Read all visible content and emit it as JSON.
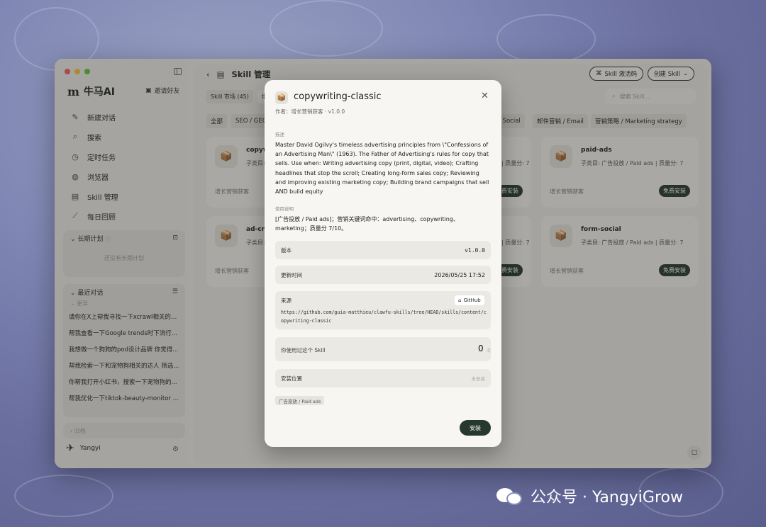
{
  "sidebar": {
    "brand_logo": "m",
    "brand": "牛马AI",
    "invite": "邀请好友",
    "nav": [
      {
        "icon": "edit-icon",
        "glyph": "✎",
        "label": "新建对话"
      },
      {
        "icon": "search-icon",
        "glyph": "⌕",
        "label": "搜索"
      },
      {
        "icon": "clock-icon",
        "glyph": "◷",
        "label": "定时任务"
      },
      {
        "icon": "globe-icon",
        "glyph": "◍",
        "label": "浏览器"
      },
      {
        "icon": "scroll-icon",
        "glyph": "▤",
        "label": "Skill 管理"
      },
      {
        "icon": "chart-icon",
        "glyph": "⟋",
        "label": "每日回顾"
      }
    ],
    "long_term": {
      "title": "长期计划",
      "empty": "还没有长期计划"
    },
    "recent": {
      "title": "最近对话",
      "group": "更早",
      "items": [
        "请你在X上帮我寻找一下xcrawl相关的帖...",
        "帮我查看一下Google trends时下流行的...",
        "我想做一个狗狗的pod设计品牌 你觉得...",
        "帮我检索一下和宠物狗相关的达人 筛选...",
        "你帮我打开小红书，搜索一下宠物狗的...",
        "帮我优化一下tiktok-beauty-monitor 改..."
      ]
    },
    "archive": "归档",
    "user": "Yangyi"
  },
  "main": {
    "title": "Skill 管理",
    "activate_btn": "Skill 激活码",
    "create_btn": "创建 Skill",
    "tabs": [
      "Skill 市场 (45)",
      "增"
    ],
    "search_placeholder": "搜索 Skill...",
    "chips": [
      "全部",
      "SEO / GEO",
      "/ Social",
      "邮件营销 / Email",
      "营销策略 / Marketing strategy"
    ],
    "cards": [
      {
        "title": "copyw",
        "sub": "子类目:",
        "author": "增长营销获客",
        "btn": ""
      },
      {
        "title": "",
        "sub": "| 质量分: 7",
        "author": "",
        "btn": "免费安装"
      },
      {
        "title": "paid-ads",
        "sub": "子类目: 广告投放 / Paid ads | 质量分: 7",
        "author": "增长营销获客",
        "btn": "免费安装"
      },
      {
        "title": "ad-cre",
        "sub": "子类目:",
        "author": "增长营销获客",
        "btn": ""
      },
      {
        "title": "",
        "sub": "| 质量分: 7",
        "author": "",
        "btn": "免费安装"
      },
      {
        "title": "form-social",
        "sub": "子类目: 广告投放 / Paid ads | 质量分: 7",
        "author": "增长营销获客",
        "btn": "免费安装"
      }
    ]
  },
  "modal": {
    "title": "copywriting-classic",
    "meta": "作者：增长营销获客 · v1.0.0",
    "desc_label": "描述",
    "description": "Master David Ogilvy's timeless advertising principles from \\\"Confessions of an Advertising Man\\\" (1963). The Father of Advertising's rules for copy that sells. Use when: Writing advertising copy (print, digital, video); Crafting headlines that stop the scroll; Creating long-form sales copy; Reviewing and improving existing marketing copy; Building brand campaigns that sell AND build equity",
    "usage_label": "使用说明",
    "usage": "[广告投放 / Paid ads]；营销关键词命中：advertising、copywriting、marketing；质量分 7/10。",
    "version_label": "版本",
    "version": "v1.0.0",
    "updated_label": "更新时间",
    "updated": "2026/05/25 17:52",
    "source_label": "来源",
    "source_badge": "GitHub",
    "source_url": "https://github.com/guia-matthieu/clawfu-skills/tree/HEAD/skills/content/copywriting-classic",
    "used_label": "你使用过这个 Skill",
    "used_count": "0",
    "used_unit": "次",
    "location_label": "安装位置",
    "location": "未安装",
    "tag": "广告投放 / Paid ads",
    "install": "安装"
  },
  "watermark": "公众号 · YangyiGrow"
}
